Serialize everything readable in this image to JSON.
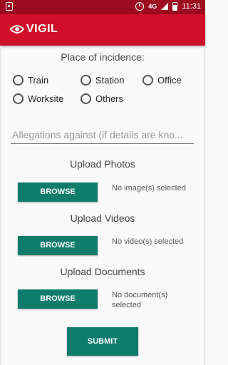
{
  "status_bar": {
    "network": "4G",
    "time": "11:31"
  },
  "app_bar": {
    "title": "VIGIL"
  },
  "form": {
    "place_heading": "Place of incidence:",
    "place_options": [
      {
        "label": "Train",
        "selected": false
      },
      {
        "label": "Station",
        "selected": false
      },
      {
        "label": "Office",
        "selected": false
      },
      {
        "label": "Worksite",
        "selected": false
      },
      {
        "label": "Others",
        "selected": false
      }
    ],
    "allegations": {
      "placeholder": "Allegations against (if details are kno...",
      "value": ""
    },
    "photos": {
      "heading": "Upload Photos",
      "button_label": "BROWSE",
      "status": "No image(s) selected"
    },
    "videos": {
      "heading": "Upload Videos",
      "button_label": "BROWSE",
      "status": "No video(s) selected"
    },
    "documents": {
      "heading": "Upload Documents",
      "button_label": "BROWSE",
      "status_line1": "No document(s)",
      "status_line2": "selected"
    },
    "submit_label": "SUBMIT"
  },
  "colors": {
    "status_bar": "#9c0a20",
    "app_bar": "#d0102a",
    "button": "#0e7c6b"
  },
  "icons": {
    "notification": "notification-icon",
    "alarm": "alarm-icon",
    "signal": "signal-icon",
    "battery": "battery-icon",
    "logo": "eye-icon"
  }
}
